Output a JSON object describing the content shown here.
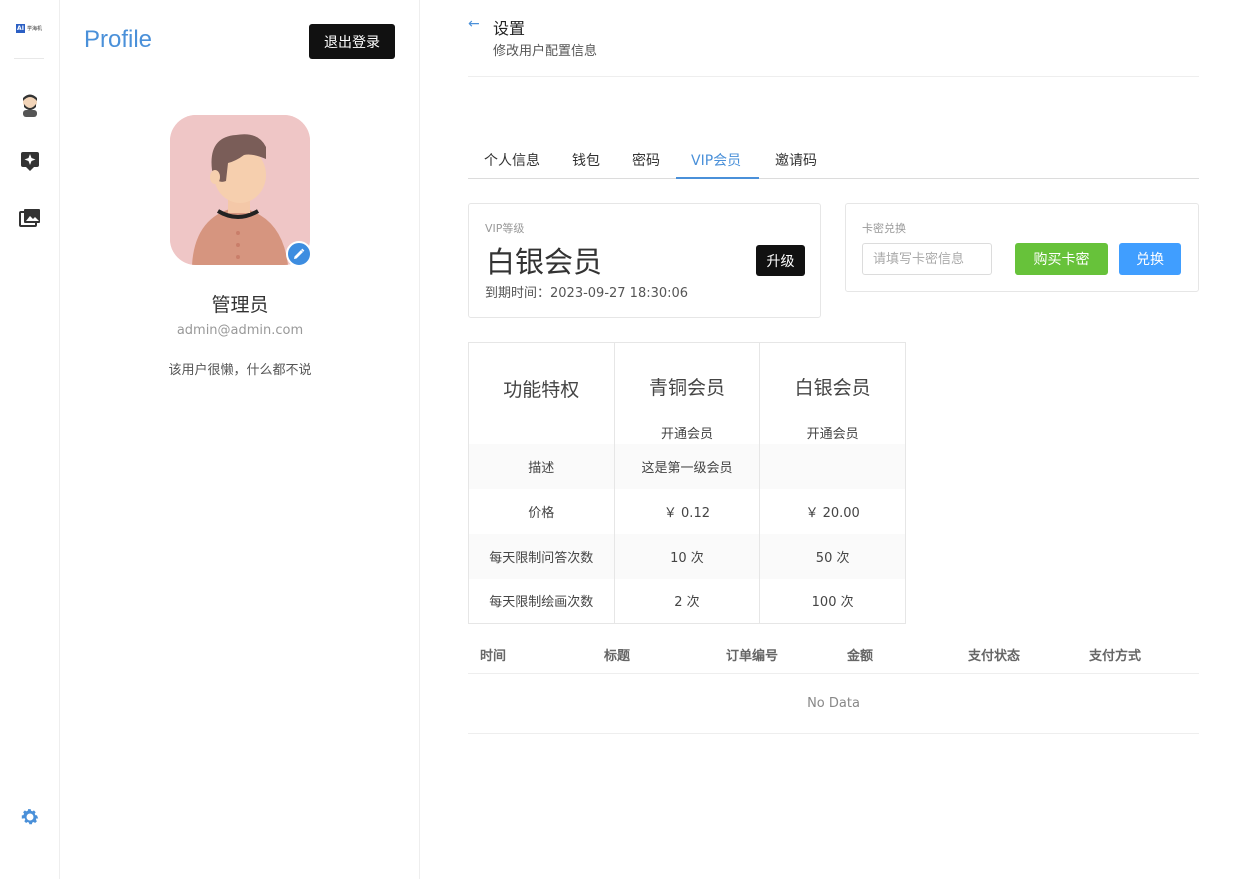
{
  "rail": {
    "logo_mark": "AI",
    "logo_text": "学海机",
    "icons": [
      "avatar-icon",
      "sparkle-icon",
      "gallery-icon",
      "gear-icon"
    ]
  },
  "profile": {
    "title": "Profile",
    "logout_label": "退出登录",
    "name": "管理员",
    "email": "admin@admin.com",
    "bio": "该用户很懒，什么都不说"
  },
  "header": {
    "title": "设置",
    "subtitle": "修改用户配置信息"
  },
  "tabs": [
    {
      "label": "个人信息",
      "active": false
    },
    {
      "label": "钱包",
      "active": false
    },
    {
      "label": "密码",
      "active": false
    },
    {
      "label": "VIP会员",
      "active": true
    },
    {
      "label": "邀请码",
      "active": false
    }
  ],
  "vip": {
    "label": "VIP等级",
    "level": "白银会员",
    "expire": "到期时间：2023-09-27 18:30:06",
    "upgrade_label": "升级"
  },
  "redeem": {
    "label": "卡密兑换",
    "placeholder": "请填写卡密信息",
    "buy_label": "购买卡密",
    "exchange_label": "兑换"
  },
  "compare": {
    "feature_header": "功能特权",
    "tiers": [
      {
        "name": "青铜会员",
        "open": "开通会员"
      },
      {
        "name": "白银会员",
        "open": "开通会员"
      }
    ],
    "rows": [
      {
        "label": "描述",
        "values": [
          "这是第一级会员",
          ""
        ]
      },
      {
        "label": "价格",
        "values": [
          "￥ 0.12",
          "￥ 20.00"
        ]
      },
      {
        "label": "每天限制问答次数",
        "values": [
          "10 次",
          "50 次"
        ]
      },
      {
        "label": "每天限制绘画次数",
        "values": [
          "2 次",
          "100 次"
        ]
      }
    ]
  },
  "orders": {
    "columns": [
      "时间",
      "标题",
      "订单编号",
      "金额",
      "支付状态",
      "支付方式"
    ],
    "empty_text": "No Data"
  },
  "colors": {
    "accent": "#4a90d9",
    "buy_green": "#67c23a",
    "exchange_blue": "#409eff",
    "dark_button": "#111111"
  }
}
